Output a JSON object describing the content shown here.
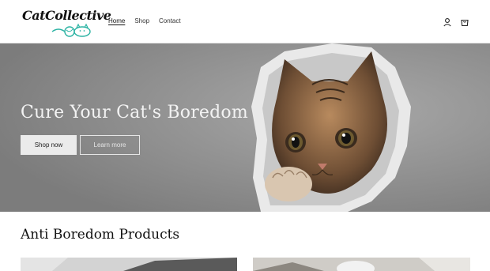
{
  "brand": {
    "logo_text": "CatCollective"
  },
  "nav": {
    "items": [
      {
        "label": "Home",
        "active": true
      },
      {
        "label": "Shop",
        "active": false
      },
      {
        "label": "Contact",
        "active": false
      }
    ]
  },
  "header_icons": [
    "account-icon",
    "cart-icon"
  ],
  "hero": {
    "title": "Cure Your Cat's Boredom",
    "primary_button": "Shop now",
    "secondary_button": "Learn more"
  },
  "section": {
    "title": "Anti Boredom Products"
  },
  "colors": {
    "hero_overlay": "#8a8a8a",
    "logo_accent": "#2bb3a3"
  }
}
